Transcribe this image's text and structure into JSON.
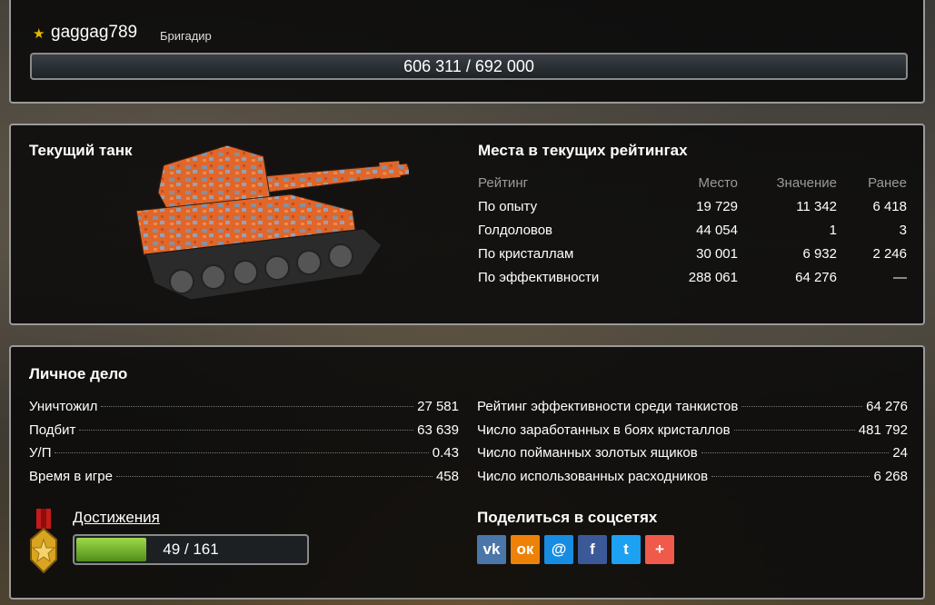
{
  "user": {
    "name": "gaggag789",
    "rank": "Бригадир",
    "xp_text": "606 311 / 692 000",
    "xp_current": 606311,
    "xp_max": 692000
  },
  "tank": {
    "title": "Текущий танк"
  },
  "ratings": {
    "title": "Места в текущих рейтингах",
    "headers": [
      "Рейтинг",
      "Место",
      "Значение",
      "Ранее"
    ],
    "rows": [
      [
        "По опыту",
        "19 729",
        "11 342",
        "6 418"
      ],
      [
        "Голдоловов",
        "44 054",
        "1",
        "3"
      ],
      [
        "По кристаллам",
        "30 001",
        "6 932",
        "2 246"
      ],
      [
        "По эффективности",
        "288 061",
        "64 276",
        "—"
      ]
    ]
  },
  "stats": {
    "title": "Личное дело",
    "left": [
      {
        "label": "Уничтожил",
        "value": "27 581"
      },
      {
        "label": "Подбит",
        "value": "63 639"
      },
      {
        "label": "У/П",
        "value": "0.43"
      },
      {
        "label": "Время в игре",
        "value": "458"
      }
    ],
    "right": [
      {
        "label": "Рейтинг эффективности среди танкистов",
        "value": "64 276"
      },
      {
        "label": "Число заработанных в боях кристаллов",
        "value": "481 792"
      },
      {
        "label": "Число пойманных золотых ящиков",
        "value": "24"
      },
      {
        "label": "Число использованных расходников",
        "value": "6 268"
      }
    ]
  },
  "achievements": {
    "link": "Достижения",
    "text": "49 / 161",
    "done": 49,
    "total": 161
  },
  "share": {
    "title": "Поделиться в соцсетях",
    "buttons": [
      {
        "name": "vk-icon",
        "glyph": "vk",
        "color": "#4a76a8"
      },
      {
        "name": "odnoklassniki-icon",
        "glyph": "ок",
        "color": "#ee8208"
      },
      {
        "name": "mail-icon",
        "glyph": "@",
        "color": "#168de2"
      },
      {
        "name": "facebook-icon",
        "glyph": "f",
        "color": "#3b5998"
      },
      {
        "name": "twitter-icon",
        "glyph": "t",
        "color": "#1da1f2"
      },
      {
        "name": "plus-icon",
        "glyph": "+",
        "color": "#f05a4a"
      }
    ]
  }
}
